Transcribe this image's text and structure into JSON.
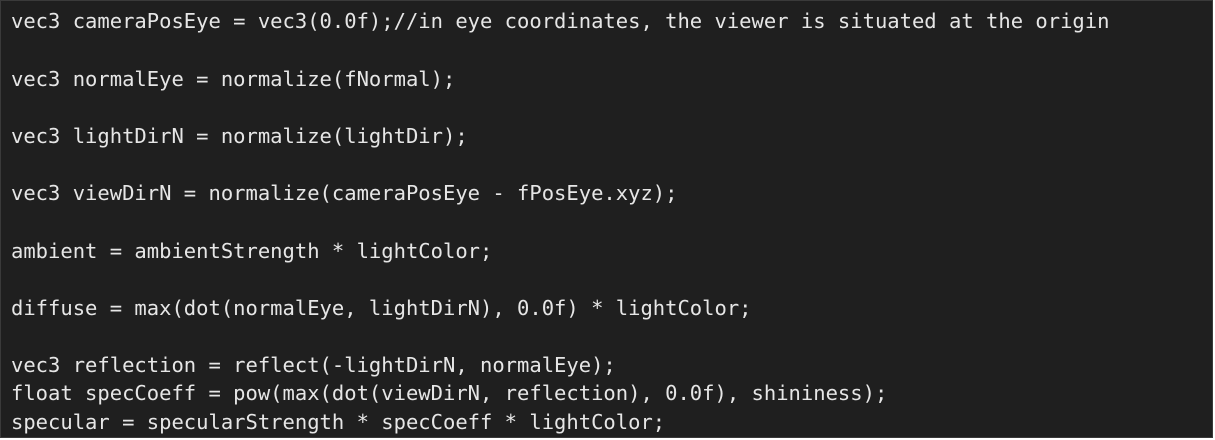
{
  "code": {
    "lines": [
      "vec3 cameraPosEye = vec3(0.0f);//in eye coordinates, the viewer is situated at the origin",
      "vec3 normalEye = normalize(fNormal);",
      "vec3 lightDirN = normalize(lightDir);",
      "vec3 viewDirN = normalize(cameraPosEye - fPosEye.xyz);",
      "ambient = ambientStrength * lightColor;",
      "diffuse = max(dot(normalEye, lightDirN), 0.0f) * lightColor;",
      "vec3 reflection = reflect(-lightDirN, normalEye);",
      "float specCoeff = pow(max(dot(viewDirN, reflection), 0.0f), shininess);",
      "specular = specularStrength * specCoeff * lightColor;"
    ]
  },
  "colors": {
    "background": "#1f1f1f",
    "text": "#e6e6e6"
  }
}
